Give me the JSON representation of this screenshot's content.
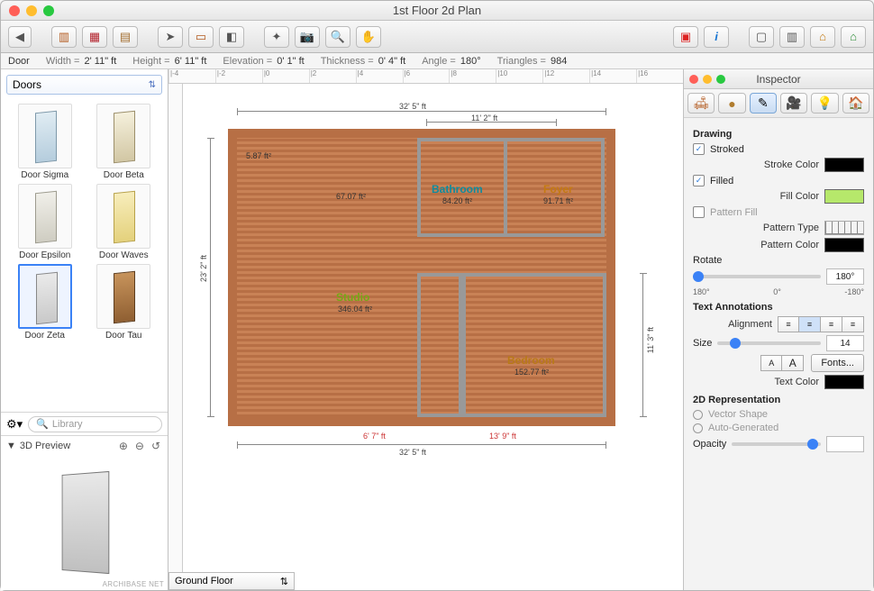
{
  "window": {
    "title": "1st Floor 2d Plan"
  },
  "status": {
    "object": "Door",
    "width_label": "Width =",
    "width": "2' 11\" ft",
    "height_label": "Height =",
    "height": "6' 11\" ft",
    "elevation_label": "Elevation =",
    "elevation": "0' 1\" ft",
    "thickness_label": "Thickness =",
    "thickness": "0' 4\" ft",
    "angle_label": "Angle =",
    "angle": "180°",
    "triangles_label": "Triangles =",
    "triangles": "984"
  },
  "library": {
    "category": "Doors",
    "search_placeholder": "Library",
    "preview_label": "3D Preview",
    "archibase": "ARCHIBASE NET",
    "items": [
      {
        "name": "Door Sigma"
      },
      {
        "name": "Door Beta"
      },
      {
        "name": "Door Epsilon"
      },
      {
        "name": "Door Waves"
      },
      {
        "name": "Door Zeta",
        "selected": true
      },
      {
        "name": "Door Tau"
      }
    ]
  },
  "floorplan": {
    "floor_selector": "Ground Floor",
    "outer_dims": {
      "top": "32' 5\" ft",
      "top_right_segment": "11' 2\" ft",
      "left": "23' 2\" ft",
      "right": "11' 3\" ft",
      "bottom": "32' 5\" ft",
      "bottom_left_segment": "6' 7\" ft",
      "bottom_right_segment": "13' 9\" ft"
    },
    "rooms": [
      {
        "name": "Studio",
        "area": "346.04 ft²",
        "color": "#76a716"
      },
      {
        "name": "Bathroom",
        "area": "84.20 ft²",
        "color": "#0f8b9e"
      },
      {
        "name": "Foyer",
        "area": "91.71 ft²",
        "color": "#c47a12"
      },
      {
        "name": "Bedroom",
        "area": "152.77 ft²",
        "color": "#b97a18"
      }
    ],
    "small_areas": {
      "pantry": "5.87 ft²",
      "closet": "67.07 ft²"
    }
  },
  "inspector": {
    "title": "Inspector",
    "section_drawing": "Drawing",
    "stroked_label": "Stroked",
    "stroked": true,
    "stroke_color_label": "Stroke Color",
    "stroke_color": "#000000",
    "filled_label": "Filled",
    "filled": true,
    "fill_color_label": "Fill Color",
    "fill_color": "#b6e86b",
    "pattern_fill_label": "Pattern Fill",
    "pattern_fill": false,
    "pattern_type_label": "Pattern Type",
    "pattern_color_label": "Pattern Color",
    "pattern_color": "#000000",
    "rotate_label": "Rotate",
    "rotate_value": "180°",
    "rotate_ticks": [
      "180°",
      "0°",
      "-180°"
    ],
    "section_text": "Text Annotations",
    "alignment_label": "Alignment",
    "size_label": "Size",
    "size_value": "14",
    "font_smaller": "A",
    "font_larger": "A",
    "fonts_button": "Fonts...",
    "text_color_label": "Text Color",
    "text_color": "#000000",
    "section_2d": "2D Representation",
    "vector_shape_label": "Vector Shape",
    "auto_generated_label": "Auto-Generated",
    "opacity_label": "Opacity"
  },
  "ruler_ticks": [
    "|-4",
    "|-2",
    "|0",
    "|2",
    "|4",
    "|6",
    "|8",
    "|10",
    "|12",
    "|14",
    "|16"
  ]
}
